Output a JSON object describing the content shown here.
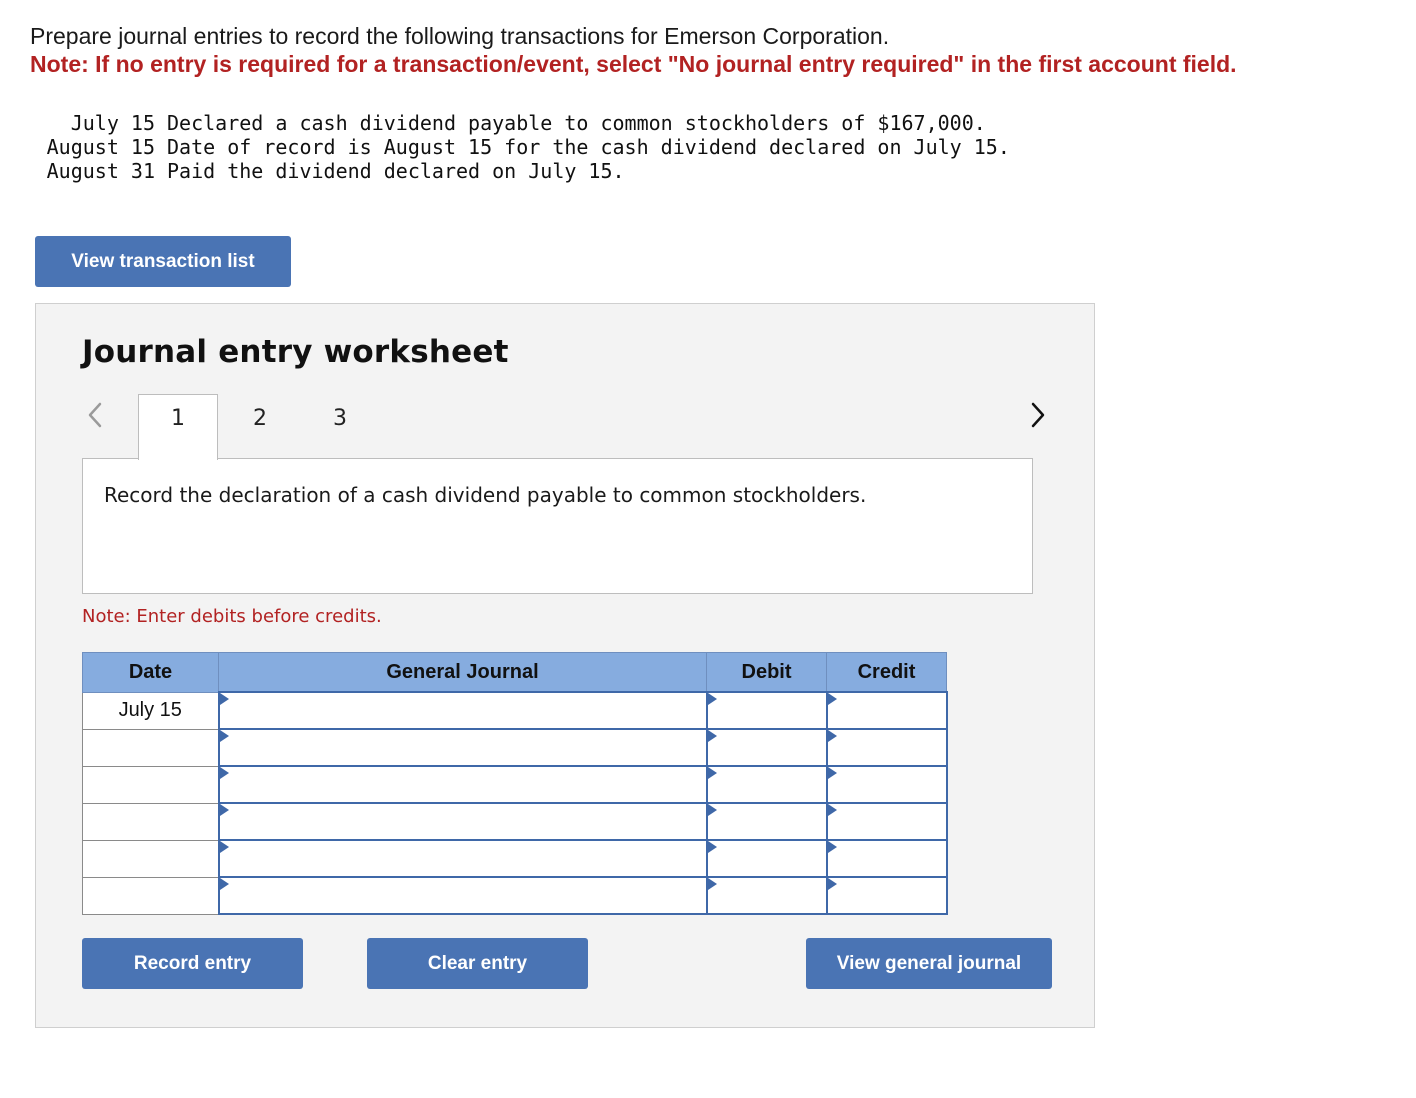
{
  "instructions": {
    "line1": "Prepare journal entries to record the following transactions for Emerson Corporation.",
    "note": "Note: If no entry is required for a transaction/event, select \"No journal entry required\" in the first account field."
  },
  "transactions": [
    {
      "date": "July 15",
      "description": "Declared a cash dividend payable to common stockholders of $167,000."
    },
    {
      "date": "August 15",
      "description": "Date of record is August 15 for the cash dividend declared on July 15."
    },
    {
      "date": "August 31",
      "description": "Paid the dividend declared on July 15."
    }
  ],
  "buttons": {
    "view_transaction_list": "View transaction list",
    "record_entry": "Record entry",
    "clear_entry": "Clear entry",
    "view_general_journal": "View general journal"
  },
  "worksheet": {
    "title": "Journal entry worksheet",
    "tabs": [
      "1",
      "2",
      "3"
    ],
    "active_tab": "1",
    "description": "Record the declaration of a cash dividend payable to common stockholders.",
    "note": "Note: Enter debits before credits.",
    "table": {
      "headers": {
        "date": "Date",
        "general_journal": "General Journal",
        "debit": "Debit",
        "credit": "Credit"
      },
      "rows": [
        {
          "date": "July 15",
          "account": "",
          "debit": "",
          "credit": ""
        },
        {
          "date": "",
          "account": "",
          "debit": "",
          "credit": ""
        },
        {
          "date": "",
          "account": "",
          "debit": "",
          "credit": ""
        },
        {
          "date": "",
          "account": "",
          "debit": "",
          "credit": ""
        },
        {
          "date": "",
          "account": "",
          "debit": "",
          "credit": ""
        },
        {
          "date": "",
          "account": "",
          "debit": "",
          "credit": ""
        }
      ]
    }
  },
  "colors": {
    "accent_button": "#4a74b4",
    "header_blue": "#86acdf",
    "note_red": "#b22222"
  }
}
